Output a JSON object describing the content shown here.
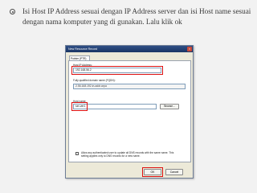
{
  "slide": {
    "text": "Isi Host IP Address sesuai dengan IP Address server dan isi Host name sesuai dengan nama komputer yang di gunakan. Lalu klik ok"
  },
  "dialog": {
    "title": "New Resource Record",
    "tab": "Pointer (PTR)",
    "ip_label": "Host IP Address:",
    "ip_value": "192.168.56.2",
    "fqdn_label": "Fully qualified domain name (FQDN):",
    "fqdn_value": "2.56.168.192.in-addr.arpa",
    "hostname_label": "Host name:",
    "hostname_value": "ser-ver1",
    "browse": "Browse...",
    "checkbox_text": "Allow any authenticated user to update all DNS records with the same name. This setting applies only to DNS records for a new name.",
    "ok": "OK",
    "cancel": "Cancel"
  },
  "colors": {
    "highlight": "#dd1111",
    "titlebar": "#1a3564"
  }
}
